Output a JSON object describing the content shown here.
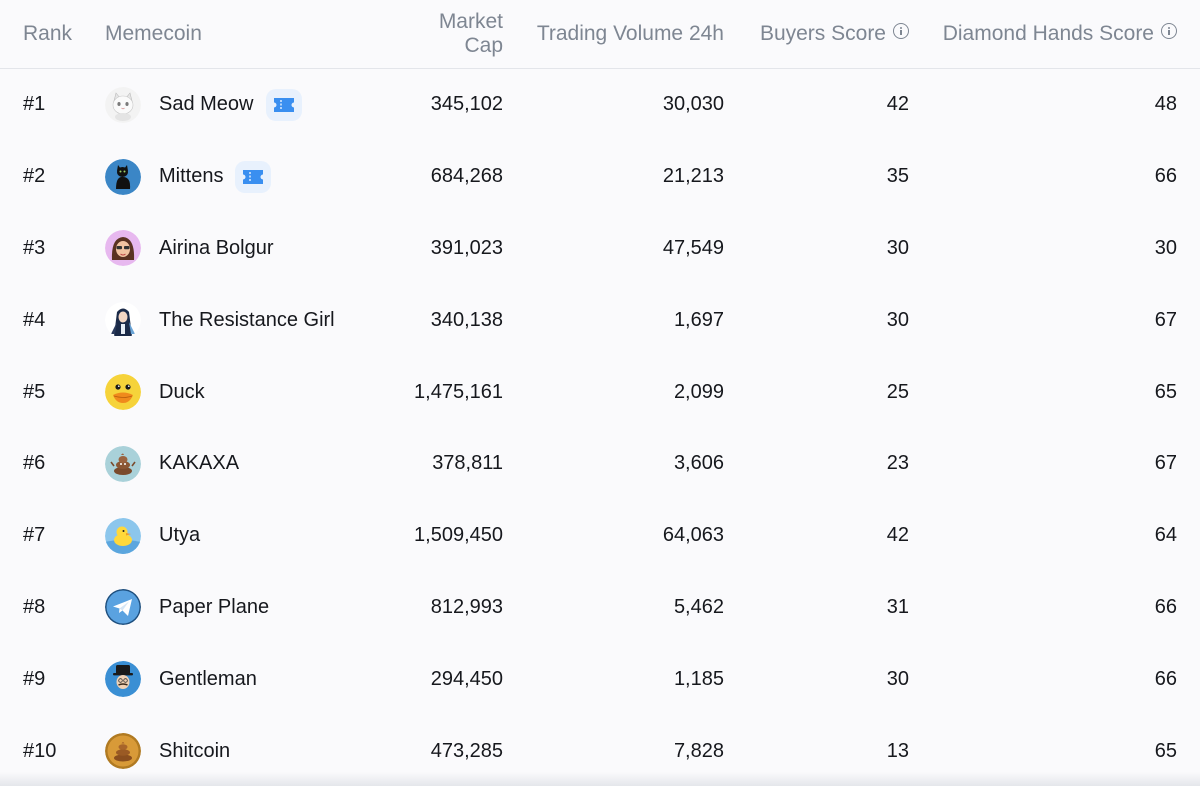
{
  "header": {
    "rank": "Rank",
    "memecoin": "Memecoin",
    "market_cap": "Market Cap",
    "volume": "Trading Volume 24h",
    "buyers": "Buyers Score",
    "diamond": "Diamond Hands Score"
  },
  "icons": {
    "info": "info-circle-icon",
    "badge": "ticket-icon"
  },
  "colors": {
    "header_text": "#7e8692",
    "body_text": "#16181d",
    "badge_bg": "#e8f1fd",
    "badge_icon": "#3a8ff0"
  },
  "rows": [
    {
      "rank": "#1",
      "name": "Sad Meow",
      "icon": "cat-avatar",
      "badge": true,
      "market_cap": "345,102",
      "volume": "30,030",
      "buyers": "42",
      "diamond": "48"
    },
    {
      "rank": "#2",
      "name": "Mittens",
      "icon": "black-cat-avatar",
      "badge": true,
      "market_cap": "684,268",
      "volume": "21,213",
      "buyers": "35",
      "diamond": "66"
    },
    {
      "rank": "#3",
      "name": "Airina Bolgur",
      "icon": "girl-avatar",
      "badge": false,
      "market_cap": "391,023",
      "volume": "47,549",
      "buyers": "30",
      "diamond": "30"
    },
    {
      "rank": "#4",
      "name": "The Resistance Girl",
      "icon": "resistance-girl-avatar",
      "badge": false,
      "market_cap": "340,138",
      "volume": "1,697",
      "buyers": "30",
      "diamond": "67"
    },
    {
      "rank": "#5",
      "name": "Duck",
      "icon": "duck-avatar",
      "badge": false,
      "market_cap": "1,475,161",
      "volume": "2,099",
      "buyers": "25",
      "diamond": "65"
    },
    {
      "rank": "#6",
      "name": "KAKAXA",
      "icon": "kakaxa-avatar",
      "badge": false,
      "market_cap": "378,811",
      "volume": "3,606",
      "buyers": "23",
      "diamond": "67"
    },
    {
      "rank": "#7",
      "name": "Utya",
      "icon": "utya-duck-avatar",
      "badge": false,
      "market_cap": "1,509,450",
      "volume": "64,063",
      "buyers": "42",
      "diamond": "64"
    },
    {
      "rank": "#8",
      "name": "Paper Plane",
      "icon": "paper-plane-avatar",
      "badge": false,
      "market_cap": "812,993",
      "volume": "5,462",
      "buyers": "31",
      "diamond": "66"
    },
    {
      "rank": "#9",
      "name": "Gentleman",
      "icon": "gentleman-avatar",
      "badge": false,
      "market_cap": "294,450",
      "volume": "1,185",
      "buyers": "30",
      "diamond": "66"
    },
    {
      "rank": "#10",
      "name": "Shitcoin",
      "icon": "shitcoin-avatar",
      "badge": false,
      "market_cap": "473,285",
      "volume": "7,828",
      "buyers": "13",
      "diamond": "65"
    }
  ]
}
